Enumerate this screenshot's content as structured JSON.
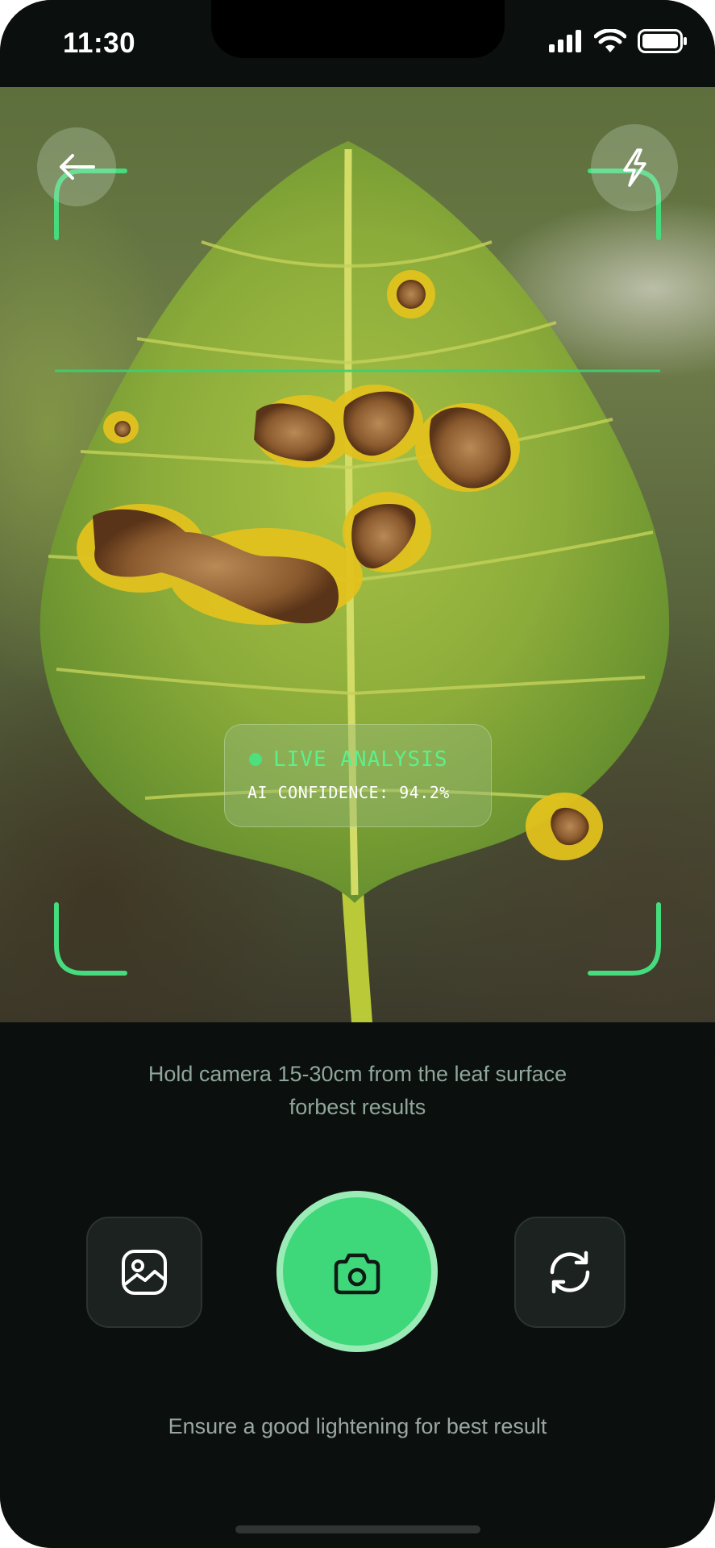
{
  "status_bar": {
    "time": "11:30",
    "icons": [
      "cellular-signal-icon",
      "wifi-icon",
      "battery-icon"
    ]
  },
  "camera": {
    "back_icon": "arrow-left-icon",
    "flash_icon": "flash-icon",
    "analysis": {
      "status": "LIVE ANALYSIS",
      "confidence": "AI CONFIDENCE: 94.2%"
    }
  },
  "panel": {
    "hint": "Hold camera 15-30cm from the leaf surface forbest results",
    "gallery_icon": "gallery-icon",
    "capture_icon": "camera-icon",
    "switch_icon": "refresh-icon",
    "tip": "Ensure a good lightening for best result"
  },
  "colors": {
    "accent": "#3ed77a",
    "accent_light": "#9bebb7",
    "background": "#0b0f0e",
    "frame": "#46dc7e"
  }
}
